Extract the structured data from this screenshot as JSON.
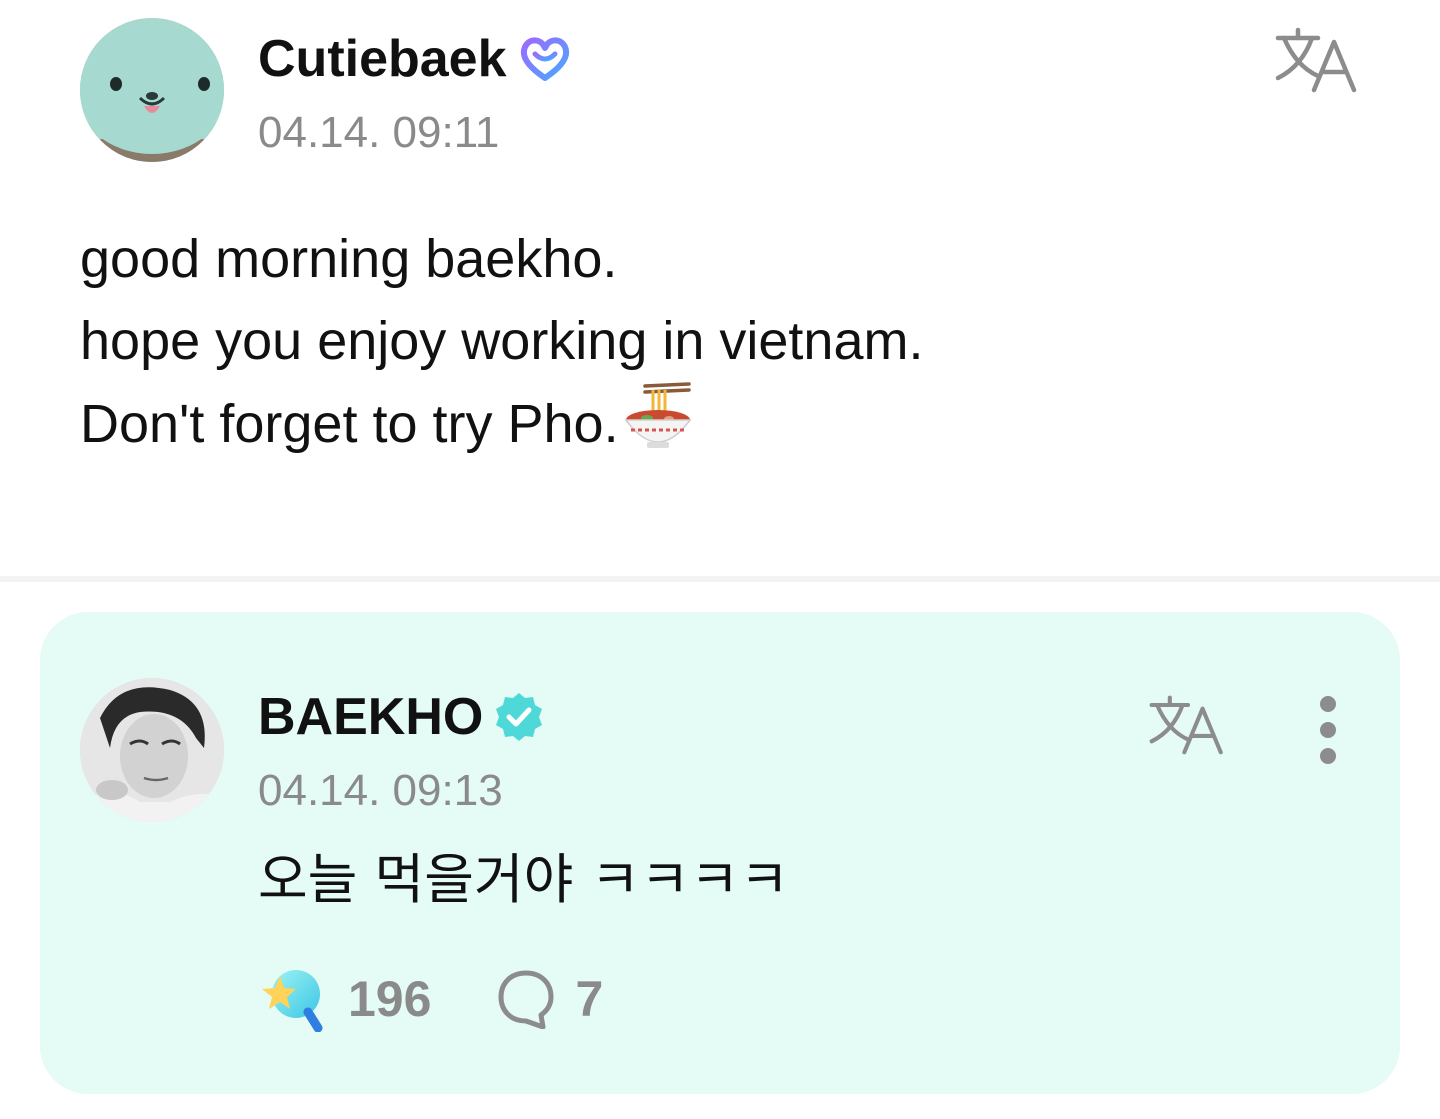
{
  "post": {
    "author": "Cutiebaek",
    "author_badge": "heart-badge-icon",
    "timestamp": "04.14. 09:11",
    "lines": [
      "good morning baekho.",
      "hope you enjoy working in vietnam.",
      "Don't forget to try Pho."
    ],
    "emoji": "steaming-bowl-icon",
    "translate_icon": "translate-icon"
  },
  "reply": {
    "author": "BAEKHO",
    "author_badge": "verified-badge-icon",
    "timestamp": "04.14. 09:13",
    "text": "오늘 먹을거야 ㅋㅋㅋㅋ",
    "translate_icon": "translate-icon",
    "more_icon": "more-vertical-icon",
    "likes": "196",
    "comments": "7",
    "card_color": "#e5fbf6",
    "badge_color": "#4fd8d8"
  }
}
